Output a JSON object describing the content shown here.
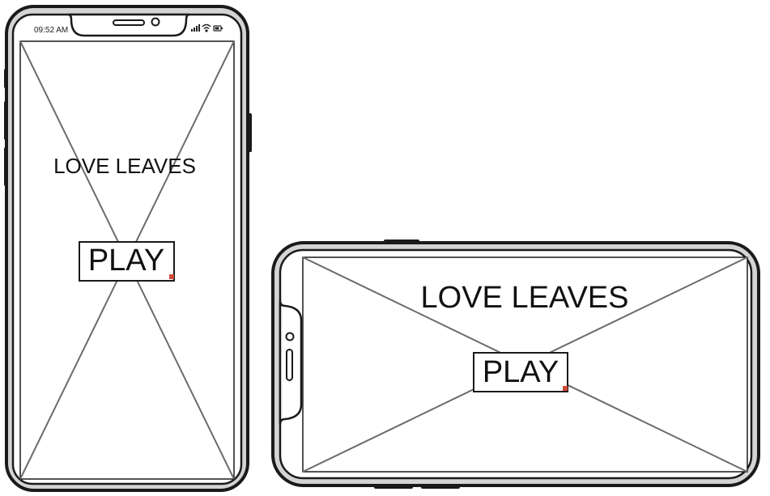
{
  "portrait_mockup": {
    "status_bar": {
      "time": "09:52 AM"
    },
    "title": "LOVE LEAVES",
    "play_button_label": "PLAY"
  },
  "landscape_mockup": {
    "title": "LOVE LEAVES",
    "play_button_label": "PLAY"
  },
  "colors": {
    "outline": "#1a1a1a",
    "bezel_fill": "#d4d4d4",
    "screen_fill": "#ffffff",
    "placeholder_line": "#6b6b6b",
    "resize_handle": "#d24a3a"
  }
}
